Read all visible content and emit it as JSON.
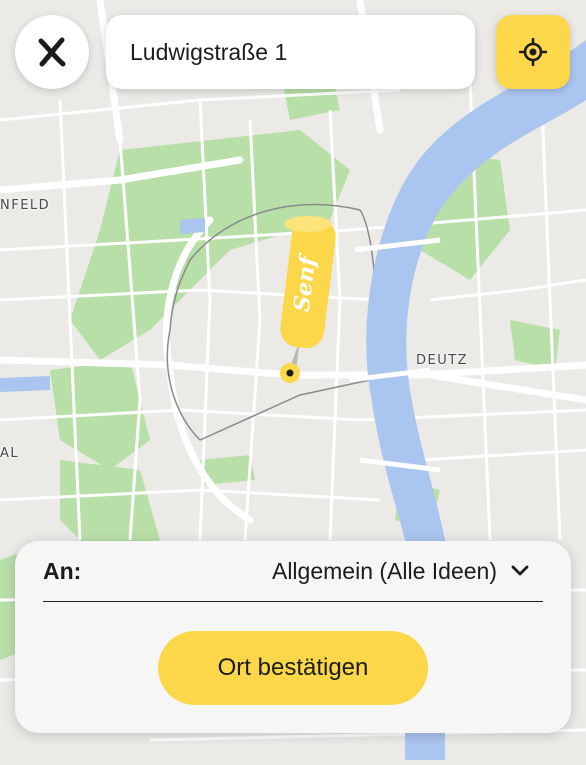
{
  "search": {
    "value": "Ludwigstraße 1"
  },
  "map": {
    "district_labels": [
      "NFELD",
      "DEUTZ",
      "AL"
    ],
    "pin_brand": "Senf"
  },
  "icons": {
    "close": "close-x-icon",
    "locate": "crosshair-locate-icon",
    "dropdown": "chevron-down-icon"
  },
  "sheet": {
    "recipient_label": "An:",
    "recipient_value": "Allgemein (Alle Ideen)",
    "confirm_label": "Ort bestätigen"
  },
  "colors": {
    "accent": "#fdd74a",
    "water": "#aac5f0",
    "park": "#b9dfa9"
  }
}
